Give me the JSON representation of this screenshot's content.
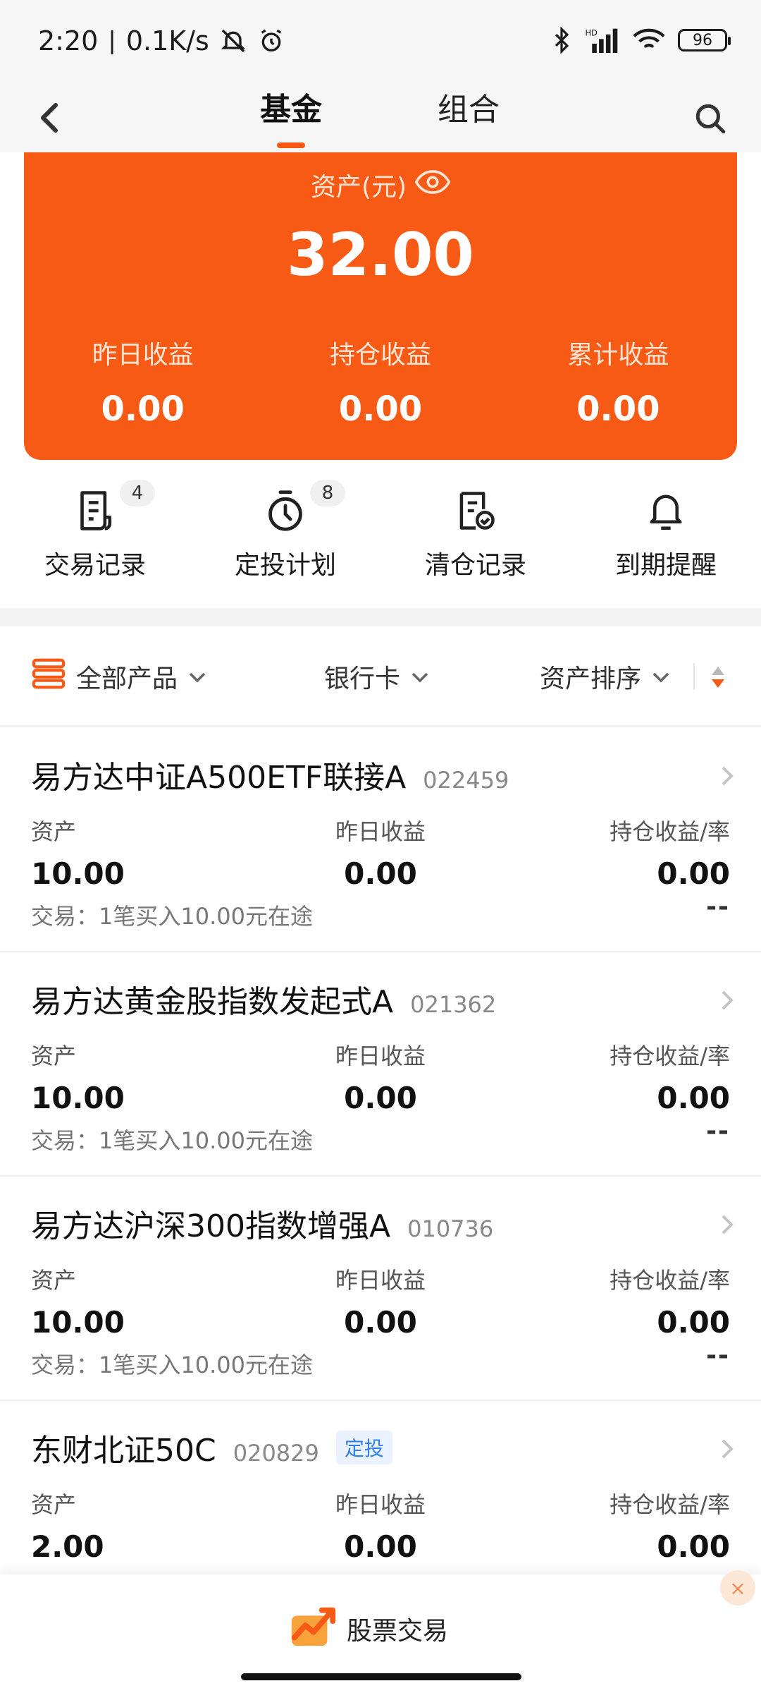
{
  "status_bar": {
    "time": "2:20",
    "net_speed": "0.1K/s",
    "battery": "96"
  },
  "nav": {
    "tabs": [
      {
        "label": "基金",
        "active": true
      },
      {
        "label": "组合",
        "active": false
      }
    ]
  },
  "asset_card": {
    "label": "资产(元)",
    "total": "32.00",
    "stats": [
      {
        "label": "昨日收益",
        "value": "0.00"
      },
      {
        "label": "持仓收益",
        "value": "0.00"
      },
      {
        "label": "累计收益",
        "value": "0.00"
      }
    ],
    "accent_color": "#f75a14"
  },
  "quick_actions": [
    {
      "label": "交易记录",
      "badge": "4",
      "icon": "receipt-icon"
    },
    {
      "label": "定投计划",
      "badge": "8",
      "icon": "timer-icon"
    },
    {
      "label": "清仓记录",
      "badge": "",
      "icon": "cleared-doc-icon"
    },
    {
      "label": "到期提醒",
      "badge": "",
      "icon": "bell-icon"
    }
  ],
  "filters": {
    "all_products": "全部产品",
    "bank_card": "银行卡",
    "asset_sort": "资产排序"
  },
  "funds": [
    {
      "name": "易方达中证A500ETF联接A",
      "code": "022459",
      "tag": "",
      "asset_label": "资产",
      "asset": "10.00",
      "yday_label": "昨日收益",
      "yday": "0.00",
      "hold_label": "持仓收益/率",
      "hold": "0.00",
      "hold_rate": "--",
      "trade": "交易：1笔买入10.00元在途"
    },
    {
      "name": "易方达黄金股指数发起式A",
      "code": "021362",
      "tag": "",
      "asset_label": "资产",
      "asset": "10.00",
      "yday_label": "昨日收益",
      "yday": "0.00",
      "hold_label": "持仓收益/率",
      "hold": "0.00",
      "hold_rate": "--",
      "trade": "交易：1笔买入10.00元在途"
    },
    {
      "name": "易方达沪深300指数增强A",
      "code": "010736",
      "tag": "",
      "asset_label": "资产",
      "asset": "10.00",
      "yday_label": "昨日收益",
      "yday": "0.00",
      "hold_label": "持仓收益/率",
      "hold": "0.00",
      "hold_rate": "--",
      "trade": "交易：1笔买入10.00元在途"
    },
    {
      "name": "东财北证50C",
      "code": "020829",
      "tag": "定投",
      "asset_label": "资产",
      "asset": "2.00",
      "yday_label": "昨日收益",
      "yday": "0.00",
      "hold_label": "持仓收益/率",
      "hold": "0.00",
      "hold_rate": "",
      "trade": ""
    }
  ],
  "bottom_bar": {
    "stock_trade": "股票交易",
    "close": "×"
  }
}
